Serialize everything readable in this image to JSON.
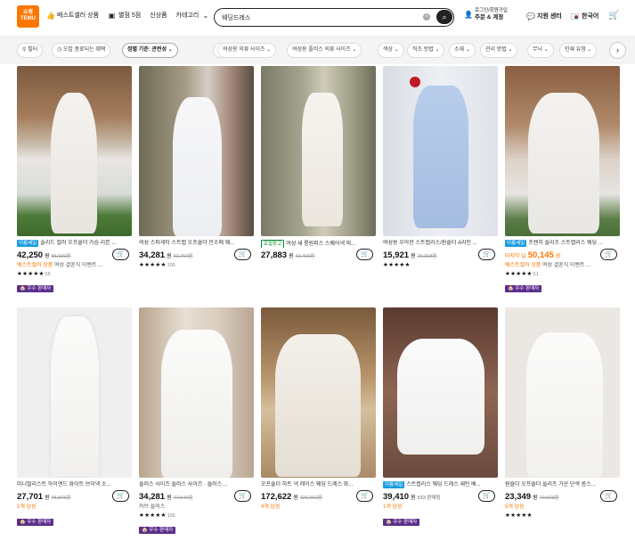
{
  "header": {
    "logo_line1": "쇼핑",
    "logo_line2": "TEMU",
    "nav": [
      {
        "label": "베스트셀러 상품",
        "icon": "thumbs-up-icon"
      },
      {
        "label": "별점 5점",
        "icon": "star-icon"
      },
      {
        "label": "신상품",
        "icon": ""
      },
      {
        "label": "카테고리",
        "icon": "chevron-down-icon"
      }
    ],
    "search_value": "웨딩드레스",
    "account_line1": "로그인/회원가입",
    "account_line2": "주문 & 계정",
    "support": "지원 센터",
    "language": "한국어"
  },
  "filters": [
    "필터",
    "오칼 종료되는 혜택",
    "정렬 기준: 관련성",
    "범주",
    "여성용 의류 사이즈",
    "여성용 플러스 의류 사이즈",
    "색상",
    "직조 방법",
    "소재",
    "관리 방법",
    "무늬",
    "인쇄 유형"
  ],
  "products": [
    {
      "badge": "이름세일",
      "badge_color": "blue",
      "title": "솔리드 컬러 오프숄더 가슴 리본 ...",
      "price": "42,250",
      "won": "원",
      "old_price": "86,020원",
      "sold": "",
      "sub": "베스트셀러 상품",
      "sub_gray": "여성 결혼식 이벤트 ...",
      "stars": "★★★★★",
      "rating_count": "55",
      "seller": "🏠 우수 판매자"
    },
    {
      "badge": "",
      "badge_color": "",
      "title": "여성 스파게티 스트랩 오프숄더 민소매 웨...",
      "price": "34,281",
      "won": "원",
      "old_price": "62,764원",
      "sold": "",
      "sub": "",
      "sub_gray": "",
      "stars": "★★★★★",
      "rating_count": "105",
      "seller": ""
    },
    {
      "badge": "로컬창고",
      "badge_color": "green",
      "title": "여성 새 롱원피스 스퀘어넥 퍼...",
      "price": "27,883",
      "won": "원",
      "old_price": "42,400원",
      "sold": "",
      "sub": "",
      "sub_gray": "",
      "stars": "",
      "rating_count": "",
      "seller": ""
    },
    {
      "badge": "",
      "badge_color": "",
      "title": "여성용 우아한 스트랩리스/원숄더 A라인 ...",
      "price": "15,921",
      "won": "원",
      "old_price": "29,318원",
      "sold": "",
      "sub": "",
      "sub_gray": "",
      "stars": "★★★★★",
      "rating_count": "",
      "seller": ""
    },
    {
      "badge": "이름세일",
      "badge_color": "blue",
      "title": "프렌치 플리츠 스트랩리스 웨딩 ...",
      "price": "50,145",
      "price_prefix": "마지막 날",
      "won": "원",
      "old_price": "",
      "sold": "",
      "sub": "베스트셀러 상품",
      "sub_gray": "여성 결혼식 이벤트 ...",
      "stars": "★★★★★",
      "rating_count": "51",
      "seller": "🏠 우수 판매자"
    },
    {
      "badge": "",
      "badge_color": "",
      "title": "미니멀리스트 하이엔드 화이트 브이넥 소...",
      "price": "27,701",
      "won": "원",
      "old_price": "45,876원",
      "sold": "",
      "sub": "1개 남음",
      "sub_gray": "",
      "stars": "",
      "rating_count": "",
      "seller": "🏠 우수 판매자"
    },
    {
      "badge": "",
      "badge_color": "",
      "title": "플러스 사이즈 플러스 사이즈 · 플러스 ...",
      "price": "34,281",
      "won": "원",
      "old_price": "77,549원",
      "sold": "",
      "sub": "",
      "sub_gray": "커브 플러스",
      "stars": "★★★★★",
      "rating_count": "165",
      "seller": "🏠 우수 판매자"
    },
    {
      "badge": "",
      "badge_color": "",
      "title": "오프숄더 하트 넥 레이스 웨딩 드레스 화...",
      "price": "172,622",
      "won": "원",
      "old_price": "226,662원",
      "sold": "",
      "sub": "4개 남음",
      "sub_gray": "",
      "stars": "",
      "rating_count": "",
      "seller": ""
    },
    {
      "badge": "이름세일",
      "badge_color": "blue",
      "title": "스트랩리스 웨딩 드레스 새틴 베...",
      "price": "39,410",
      "won": "원",
      "old_price": "",
      "sold": "533 판매됨",
      "sub": "1개 남음",
      "sub_gray": "",
      "stars": "",
      "rating_count": "",
      "seller": "🏠 우수 판매자"
    },
    {
      "badge": "",
      "badge_color": "",
      "title": "원숄더 오프숄더 플리츠 가운 단색 롱스...",
      "price": "23,349",
      "won": "원",
      "old_price": "70,603원",
      "sold": "",
      "sub": "5개 남음",
      "sub_gray": "",
      "stars": "★★★★★",
      "rating_count": "",
      "seller": ""
    }
  ],
  "colors": {
    "accent": "#fb7701",
    "seller": "#5b2d8c",
    "sale_badge": "#1a9ce0"
  }
}
